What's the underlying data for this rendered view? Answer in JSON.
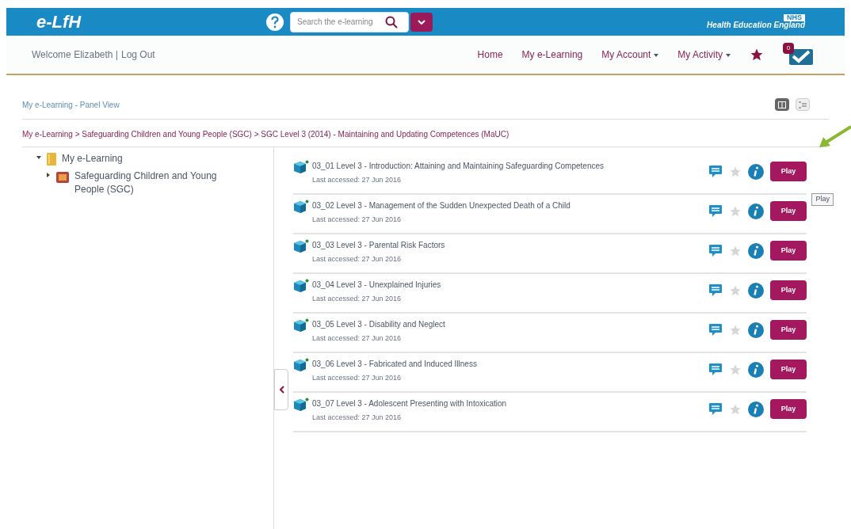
{
  "logo": "e-LfH",
  "search": {
    "placeholder": "Search the e-learning"
  },
  "nhs": {
    "badge": "NHS",
    "org": "Health Education England"
  },
  "welcome": {
    "text": "Welcome Elizabeth |",
    "logout": "Log Out"
  },
  "nav": [
    {
      "label": "Home",
      "dropdown": false
    },
    {
      "label": "My e-Learning",
      "dropdown": false
    },
    {
      "label": "My Account",
      "dropdown": true
    },
    {
      "label": "My Activity",
      "dropdown": true
    }
  ],
  "message_count": "0",
  "page_title": "My e-Learning - Panel View",
  "views": [
    {
      "kind": "panel",
      "selected": true
    },
    {
      "kind": "list",
      "selected": false
    }
  ],
  "breadcrumb": "My e-Learning > Safeguarding Children and Young People (SGC) > SGC Level 3 (2014) - Maintaining and Updating Competences (MaUC)",
  "tree": [
    {
      "label": "My e-Learning",
      "expanded": true,
      "kind": "folder",
      "children": [
        {
          "label": "Safeguarding Children and Young People (SGC)",
          "expanded": false,
          "kind": "course"
        }
      ]
    }
  ],
  "sessions": [
    {
      "title": "03_01 Level 3 - Introduction: Attaining and Maintaining Safeguarding Competences",
      "accessed": "Last accessed: 27 Jun 2016",
      "favourite": false,
      "action": "Play"
    },
    {
      "title": "03_02 Level 3 - Management of the Sudden Unexpected Death of a Child",
      "accessed": "Last accessed: 27 Jun 2016",
      "favourite": false,
      "action": "Play"
    },
    {
      "title": "03_03 Level 3 - Parental Risk Factors",
      "accessed": "Last accessed: 27 Jun 2016",
      "favourite": false,
      "action": "Play"
    },
    {
      "title": "03_04 Level 3 - Unexplained Injuries",
      "accessed": "Last accessed: 27 Jun 2016",
      "favourite": false,
      "action": "Play"
    },
    {
      "title": "03_05 Level 3 - Disability and Neglect",
      "accessed": "Last accessed: 27 Jun 2016",
      "favourite": false,
      "action": "Play"
    },
    {
      "title": "03_06 Level 3 - Fabricated and Induced Illness",
      "accessed": "Last accessed: 27 Jun 2016",
      "favourite": false,
      "action": "Play"
    },
    {
      "title": "03_07 Level 3 - Adolescent Presenting with Intoxication",
      "accessed": "Last accessed: 27 Jun 2016",
      "favourite": false,
      "action": "Play"
    }
  ],
  "tooltip": "Play"
}
